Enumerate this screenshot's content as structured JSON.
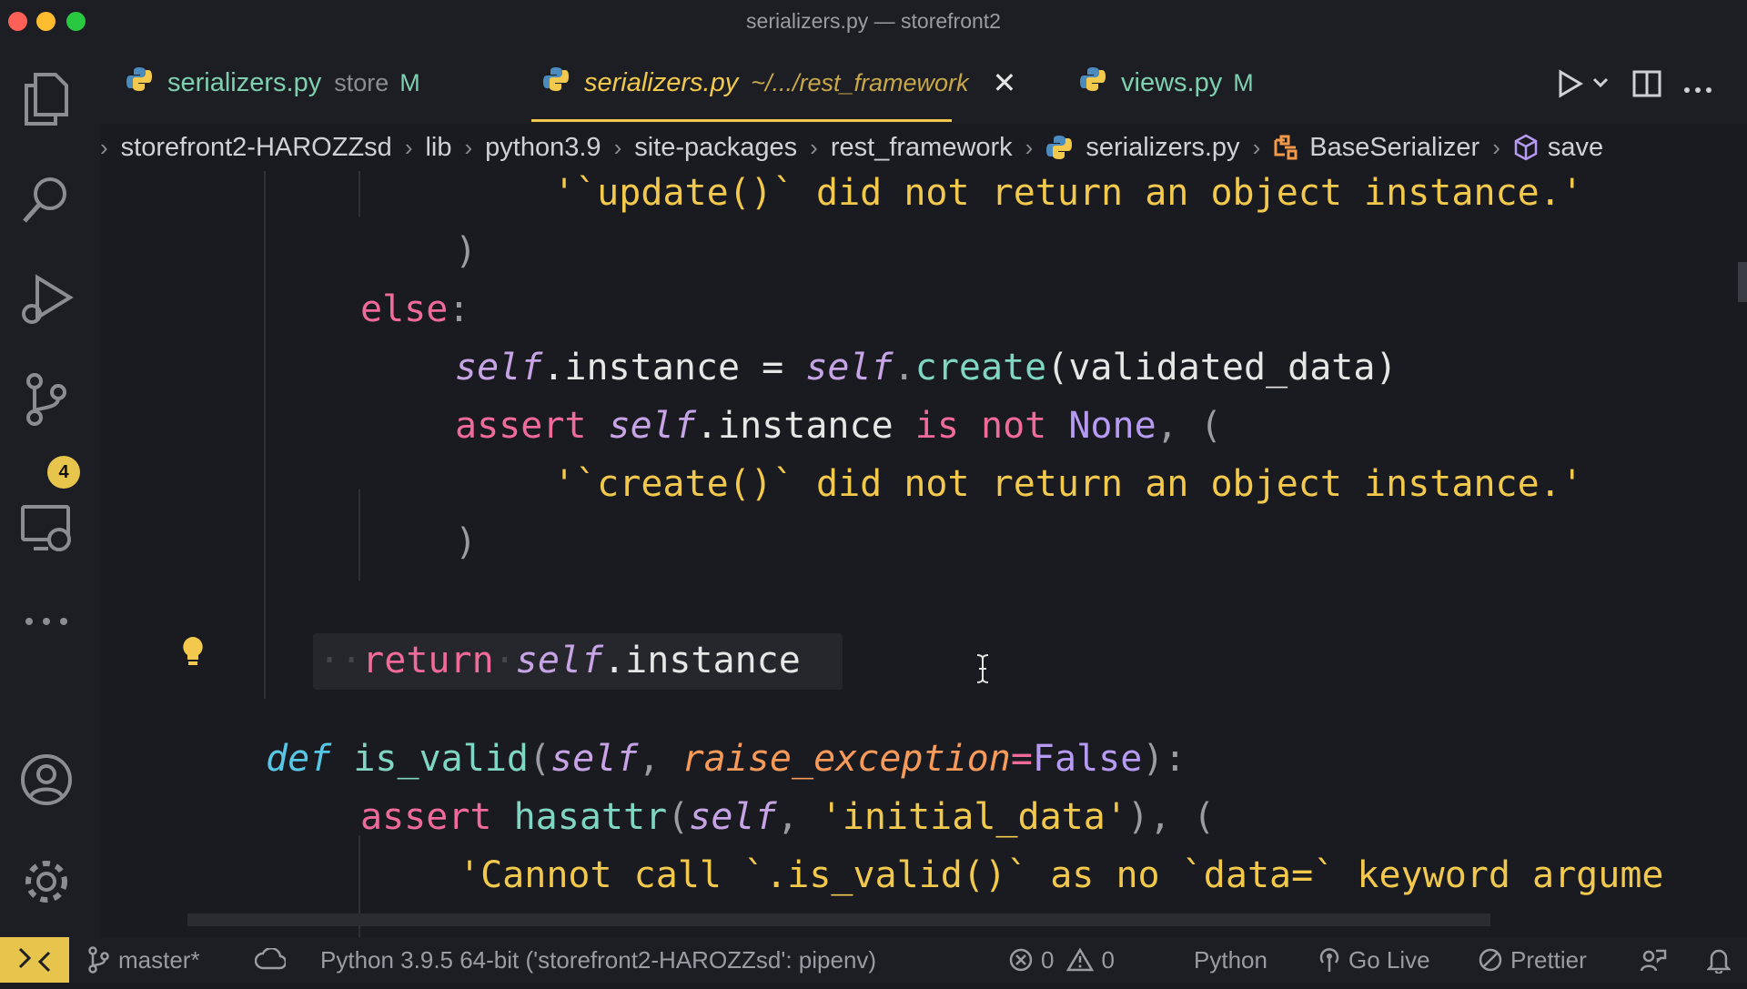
{
  "window": {
    "title": "serializers.py — storefront2"
  },
  "activity": {
    "source_control_badge": "4"
  },
  "tabs": [
    {
      "name": "serializers.py",
      "desc": "store",
      "mod": "M"
    },
    {
      "name": "serializers.py",
      "desc": "~/.../rest_framework"
    },
    {
      "name": "views.py",
      "mod": "M"
    }
  ],
  "breadcrumb": [
    "storefront2-HAROZZsd",
    "lib",
    "python3.9",
    "site-packages",
    "rest_framework",
    "serializers.py",
    "BaseSerializer",
    "save"
  ],
  "code": {
    "l1_str": "'`update()` did not return an object instance.'",
    "l2": ")",
    "l3_kw": "else",
    "l3_colon": ":",
    "l4_self": "self",
    "l4_a": ".instance = ",
    "l4_self2": "self",
    "l4_dot": ".",
    "l4_fn": "create",
    "l4_b": "(validated_data)",
    "l5_kw": "assert",
    "l5_self": "self",
    "l5_a": ".instance ",
    "l5_is": "is not",
    "l5_none": "None",
    "l5_b": ", (",
    "l6_str": "'`create()` did not return an object instance.'",
    "l7": ")",
    "l9_kw": "return",
    "l9_self": "self",
    "l9_a": ".instance",
    "l10_def": "def",
    "l10_fn": "is_valid",
    "l10_a": "(",
    "l10_self": "self",
    "l10_b": ", ",
    "l10_param": "raise_exception",
    "l10_eq": "=",
    "l10_false": "False",
    "l10_c": "):",
    "l11_kw": "assert",
    "l11_fn": "hasattr",
    "l11_a": "(",
    "l11_self": "self",
    "l11_b": ", ",
    "l11_str": "'initial_data'",
    "l11_c": "), (",
    "l12_str": "'Cannot call `.is_valid()` as no `data=` keyword argume"
  },
  "status": {
    "branch": "master*",
    "interpreter": "Python 3.9.5 64-bit ('storefront2-HAROZZsd': pipenv)",
    "errors": "0",
    "warnings": "0",
    "language": "Python",
    "go_live": "Go Live",
    "prettier": "Prettier"
  },
  "colors": {
    "accent": "#f2c94c",
    "tab_modified": "#7fd0b0",
    "badge": "#e7c44b"
  },
  "icons": [
    "explorer-icon",
    "search-icon",
    "run-debug-icon",
    "source-control-icon",
    "remote-explorer-icon",
    "more-icon",
    "account-icon",
    "settings-gear-icon",
    "python-file-icon",
    "close-icon",
    "run-icon",
    "split-editor-icon",
    "lightbulb-icon",
    "text-cursor-icon",
    "remote-icon",
    "branch-icon",
    "sync-icon",
    "error-icon",
    "warning-icon",
    "broadcast-icon",
    "prettier-icon",
    "feedback-icon",
    "bell-icon"
  ]
}
